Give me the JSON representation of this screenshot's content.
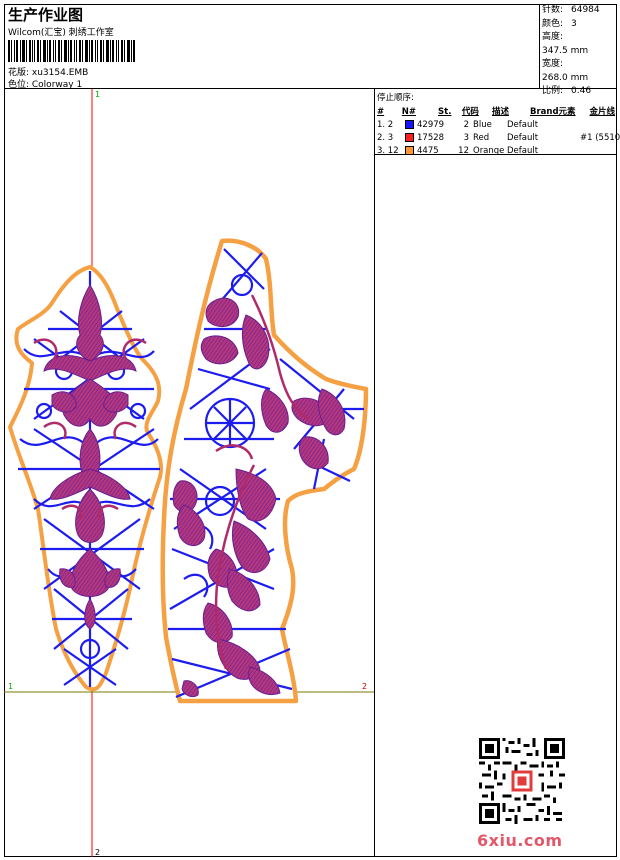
{
  "header": {
    "title": "生产作业图",
    "subtitle": "Wilcom(汇宝) 刺绣工作室",
    "file_line": "花版: xu3154.EMB",
    "colorway_line": "色位:  Colorway 1"
  },
  "stats": [
    {
      "key": "针数:",
      "value": "64984"
    },
    {
      "key": "颜色:",
      "value": "3"
    },
    {
      "key": "高度:",
      "value": "347.5 mm"
    },
    {
      "key": "宽度:",
      "value": "268.0 mm"
    },
    {
      "key": "比例:",
      "value": "0.46"
    }
  ],
  "stop_sequence": {
    "title": "停止顺序:",
    "headers": [
      "#",
      "N#",
      "St.",
      "代码",
      "描述",
      "Brand",
      "元素",
      "金片线"
    ],
    "rows": [
      {
        "idx": "1.",
        "n": "2",
        "color": "#1414ff",
        "stitches": "42979",
        "code": "2",
        "desc": "Blue",
        "brand": "Default",
        "element": "",
        "sequin": ""
      },
      {
        "idx": "2.",
        "n": "3",
        "color": "#ff1e1e",
        "stitches": "17528",
        "code": "3",
        "desc": "Red",
        "brand": "Default",
        "element": "",
        "sequin": "#1 (5510)"
      },
      {
        "idx": "3.",
        "n": "12",
        "color": "#ff9632",
        "stitches": "4475",
        "code": "12",
        "desc": "Orange",
        "brand": "Default",
        "element": "",
        "sequin": ""
      }
    ]
  },
  "canvas": {
    "marker_top": "1",
    "marker_bottom": "2",
    "marker_left": "1",
    "marker_right": "2"
  },
  "watermark": "6xiu.com",
  "colors": {
    "blue": "#1c1cf0",
    "red": "#b02a6a",
    "orange": "#f5a043",
    "guide_red": "#ff0000",
    "guide_olive": "#7a7a00"
  }
}
